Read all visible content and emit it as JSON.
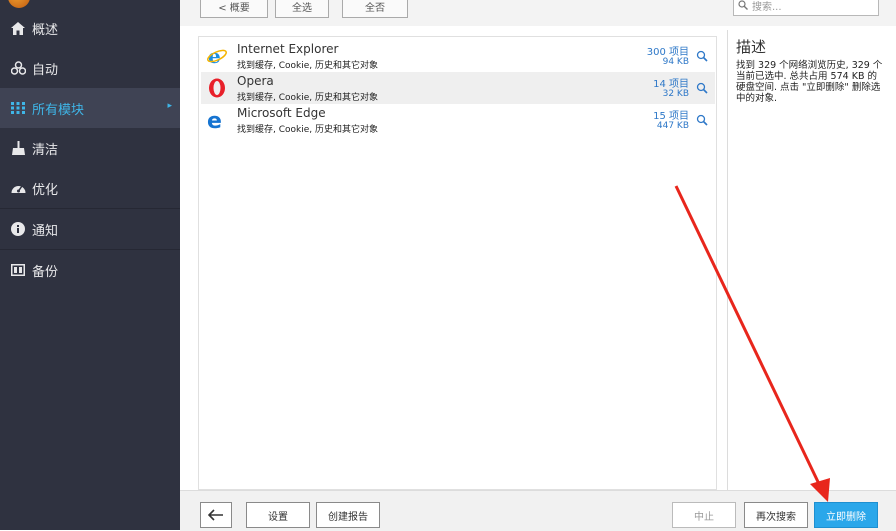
{
  "app": {
    "logo_text": ""
  },
  "sidebar": {
    "items": [
      {
        "label": "概述",
        "icon": "home-icon"
      },
      {
        "label": "自动",
        "icon": "auto-icon"
      },
      {
        "label": "所有模块",
        "icon": "grid-icon",
        "active": true
      },
      {
        "label": "清洁",
        "icon": "broom-icon"
      },
      {
        "label": "优化",
        "icon": "speedometer-icon"
      },
      {
        "label": "通知",
        "icon": "info-icon"
      },
      {
        "label": "备份",
        "icon": "backup-icon"
      }
    ]
  },
  "toolbar": {
    "back_label": "< 概要",
    "select_all_label": "全选",
    "select_none_label": "全否",
    "search_placeholder": "搜索..."
  },
  "browsers": [
    {
      "name": "Internet Explorer",
      "desc": "找到缓存, Cookie, 历史和其它对象",
      "count": "300 项目",
      "size": "94 KB",
      "icon": "internet-explorer-icon"
    },
    {
      "name": "Opera",
      "desc": "找到缓存, Cookie, 历史和其它对象",
      "count": "14 项目",
      "size": "32 KB",
      "icon": "opera-icon"
    },
    {
      "name": "Microsoft Edge",
      "desc": "找到缓存, Cookie, 历史和其它对象",
      "count": "15 项目",
      "size": "447 KB",
      "icon": "microsoft-edge-icon"
    }
  ],
  "description": {
    "title": "描述",
    "body": "找到 329 个网络浏览历史, 329 个当前已选中. 总共占用 574 KB 的硬盘空间. 点击 \"立即删除\" 删除选中的对象."
  },
  "bottombar": {
    "settings_label": "设置",
    "report_label": "创建报告",
    "stop_label": "中止",
    "rescan_label": "再次搜索",
    "delete_label": "立即删除"
  },
  "colors": {
    "accent": "#2aa7ea",
    "sidebar_bg": "#2f3240",
    "annotation": "#e8261c"
  }
}
